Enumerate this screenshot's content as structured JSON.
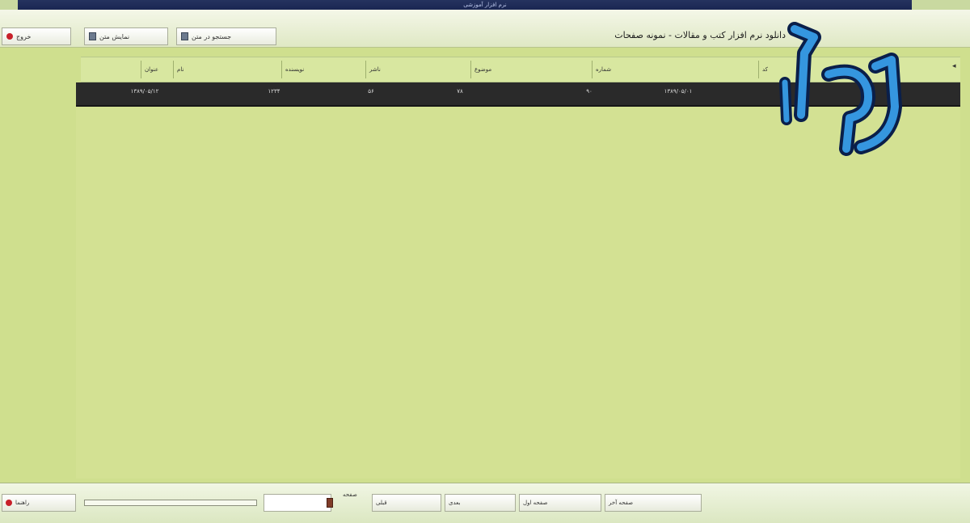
{
  "window": {
    "title": "نرم افزار آموزشی"
  },
  "toolbar": {
    "buttons": [
      {
        "label": "خروج"
      },
      {
        "label": "نمایش متن"
      },
      {
        "label": "جستجو در متن"
      }
    ],
    "document_title": "دانلود نرم افزار کتب و مقالات - نمونه صفحات"
  },
  "table": {
    "columns": [
      "عنوان",
      "نام",
      "نویسنده",
      "ناشر",
      "موضوع",
      "شماره",
      "کد"
    ],
    "selected_row": [
      "۱۳۸۹/۰۵/۱۲",
      "۱۲۳۴",
      "۵۶",
      "۷۸",
      "۹۰",
      "۱۳۸۹/۰۵/۰۱"
    ]
  },
  "status": {
    "left_button": "راهنما",
    "label": "صفحه",
    "buttons": [
      "قبلی",
      "بعدی",
      "صفحه اول",
      "صفحه آخر"
    ]
  },
  "colors": {
    "background": "#cfdf8e",
    "selected_row": "#2a2a2a",
    "logo_blue": "#2e8fd8"
  }
}
